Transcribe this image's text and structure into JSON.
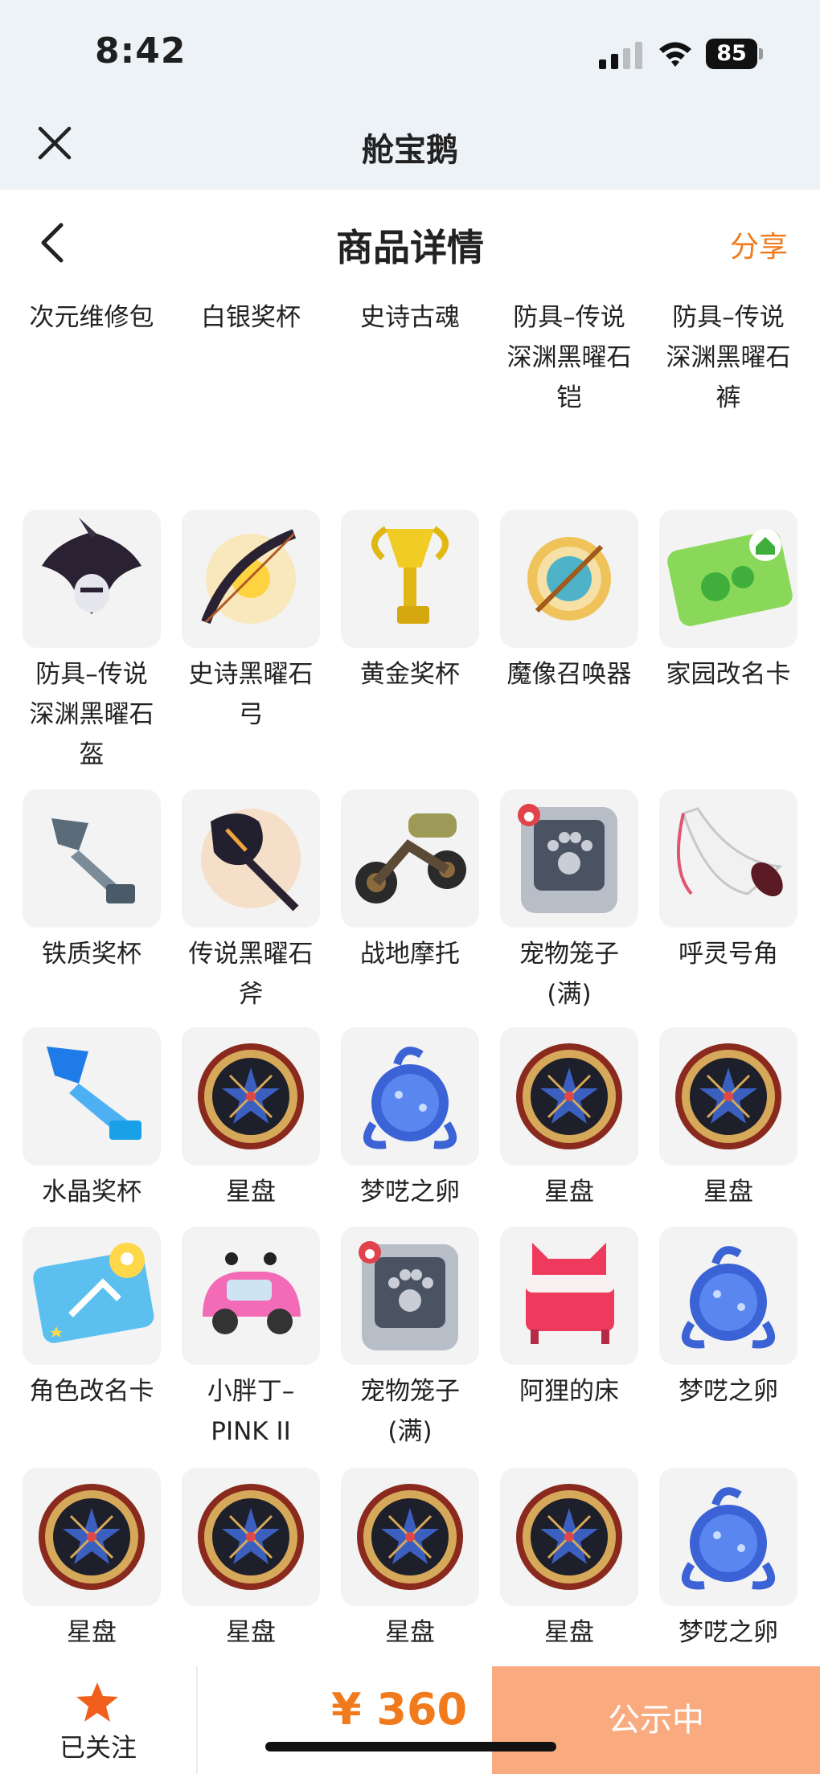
{
  "status_bar": {
    "time": "8:42",
    "battery": "85"
  },
  "app_bar": {
    "title": "舱宝鹅"
  },
  "nav_bar": {
    "title": "商品详情",
    "share": "分享"
  },
  "colors": {
    "accent": "#f07a1c",
    "cta_bg": "#f9ab7f",
    "tile_bg": "#f3f3f3",
    "status_bg": "#edf2f7"
  },
  "grid": {
    "rows": [
      {
        "items": [
          {
            "label": "次元维修包",
            "icon": "repair-bag-icon"
          },
          {
            "label": "白银奖杯",
            "icon": "silver-trophy-icon"
          },
          {
            "label": "史诗古魂",
            "icon": "epic-spear-icon"
          },
          {
            "label": "防具–传说\n深渊黑曜石\n铠",
            "icon": "obsidian-armor-icon"
          },
          {
            "label": "防具–传说\n深渊黑曜石\n裤",
            "icon": "obsidian-pants-icon"
          }
        ]
      },
      {
        "items": [
          {
            "label": "防具–传说\n深渊黑曜石\n盔",
            "icon": "obsidian-helmet-icon"
          },
          {
            "label": "史诗黑曜石\n弓",
            "icon": "obsidian-bow-icon"
          },
          {
            "label": "黄金奖杯",
            "icon": "gold-trophy-icon"
          },
          {
            "label": "魔像召唤器",
            "icon": "golem-summoner-icon"
          },
          {
            "label": "家园改名卡",
            "icon": "home-rename-card-icon"
          }
        ]
      },
      {
        "items": [
          {
            "label": "铁质奖杯",
            "icon": "iron-trophy-icon"
          },
          {
            "label": "传说黑曜石\n斧",
            "icon": "obsidian-axe-icon"
          },
          {
            "label": "战地摩托",
            "icon": "motorbike-icon"
          },
          {
            "label": "宠物笼子\n(满)",
            "icon": "pet-cage-icon"
          },
          {
            "label": "呼灵号角",
            "icon": "horn-icon"
          }
        ]
      },
      {
        "items": [
          {
            "label": "水晶奖杯",
            "icon": "crystal-trophy-icon"
          },
          {
            "label": "星盘",
            "icon": "star-disk-icon"
          },
          {
            "label": "梦呓之卵",
            "icon": "dream-egg-icon"
          },
          {
            "label": "星盘",
            "icon": "star-disk-icon"
          },
          {
            "label": "星盘",
            "icon": "star-disk-icon"
          }
        ]
      },
      {
        "items": [
          {
            "label": "角色改名卡",
            "icon": "role-rename-card-icon"
          },
          {
            "label": "小胖丁–\nPINK II",
            "icon": "pink-car-icon"
          },
          {
            "label": "宠物笼子\n(满)",
            "icon": "pet-cage-icon"
          },
          {
            "label": "阿狸的床",
            "icon": "fox-bed-icon"
          },
          {
            "label": "梦呓之卵",
            "icon": "dream-egg-icon"
          }
        ]
      },
      {
        "items": [
          {
            "label": "星盘",
            "icon": "star-disk-icon"
          },
          {
            "label": "星盘",
            "icon": "star-disk-icon"
          },
          {
            "label": "星盘",
            "icon": "star-disk-icon"
          },
          {
            "label": "星盘",
            "icon": "star-disk-icon"
          },
          {
            "label": "梦呓之卵",
            "icon": "dream-egg-icon"
          }
        ]
      }
    ]
  },
  "bottom_bar": {
    "follow_label": "已关注",
    "price": "¥ 360",
    "cta_label": "公示中"
  }
}
